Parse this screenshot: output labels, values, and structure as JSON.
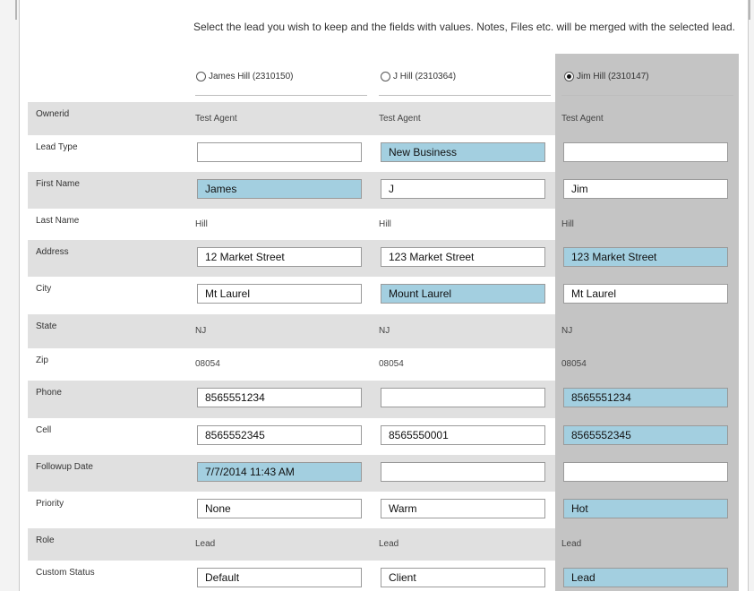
{
  "instructions": "Select the lead you wish to keep and the fields with values. Notes, Files etc. will be merged with the selected lead.",
  "colors": {
    "highlight": "#a3cfe0",
    "selected_column": "#c4c4c4",
    "row_shade": "#e0e0e0"
  },
  "leads": [
    {
      "label": "James Hill (2310150)",
      "selected": false
    },
    {
      "label": "J Hill (2310364)",
      "selected": false
    },
    {
      "label": "Jim Hill (2310147)",
      "selected": true
    }
  ],
  "rows": [
    {
      "label": "Ownerid",
      "type": "static",
      "values": [
        "Test Agent",
        "Test Agent",
        "Test Agent"
      ]
    },
    {
      "label": "Lead Type",
      "type": "input",
      "values": [
        "",
        "New Business",
        ""
      ],
      "highlighted": [
        false,
        true,
        false
      ]
    },
    {
      "label": "First Name",
      "type": "input",
      "values": [
        "James",
        "J",
        "Jim"
      ],
      "highlighted": [
        true,
        false,
        false
      ]
    },
    {
      "label": "Last Name",
      "type": "static",
      "values": [
        "Hill",
        "Hill",
        "Hill"
      ]
    },
    {
      "label": "Address",
      "type": "input",
      "values": [
        "12 Market Street",
        "123 Market Street",
        "123 Market Street"
      ],
      "highlighted": [
        false,
        false,
        true
      ]
    },
    {
      "label": "City",
      "type": "input",
      "values": [
        "Mt Laurel",
        "Mount Laurel",
        "Mt Laurel"
      ],
      "highlighted": [
        false,
        true,
        false
      ]
    },
    {
      "label": "State",
      "type": "static",
      "values": [
        "NJ",
        "NJ",
        "NJ"
      ]
    },
    {
      "label": "Zip",
      "type": "static",
      "values": [
        "08054",
        "08054",
        "08054"
      ]
    },
    {
      "label": "Phone",
      "type": "input",
      "values": [
        "8565551234",
        "",
        "8565551234"
      ],
      "highlighted": [
        false,
        false,
        true
      ]
    },
    {
      "label": "Cell",
      "type": "input",
      "values": [
        "8565552345",
        "8565550001",
        "8565552345"
      ],
      "highlighted": [
        false,
        false,
        true
      ]
    },
    {
      "label": "Followup Date",
      "type": "input",
      "values": [
        "7/7/2014 11:43 AM",
        "",
        ""
      ],
      "highlighted": [
        true,
        false,
        false
      ]
    },
    {
      "label": "Priority",
      "type": "input",
      "values": [
        "None",
        "Warm",
        "Hot"
      ],
      "highlighted": [
        false,
        false,
        true
      ]
    },
    {
      "label": "Role",
      "type": "static",
      "values": [
        "Lead",
        "Lead",
        "Lead"
      ]
    },
    {
      "label": "Custom Status",
      "type": "input",
      "values": [
        "Default",
        "Client",
        "Lead"
      ],
      "highlighted": [
        false,
        false,
        true
      ]
    }
  ]
}
